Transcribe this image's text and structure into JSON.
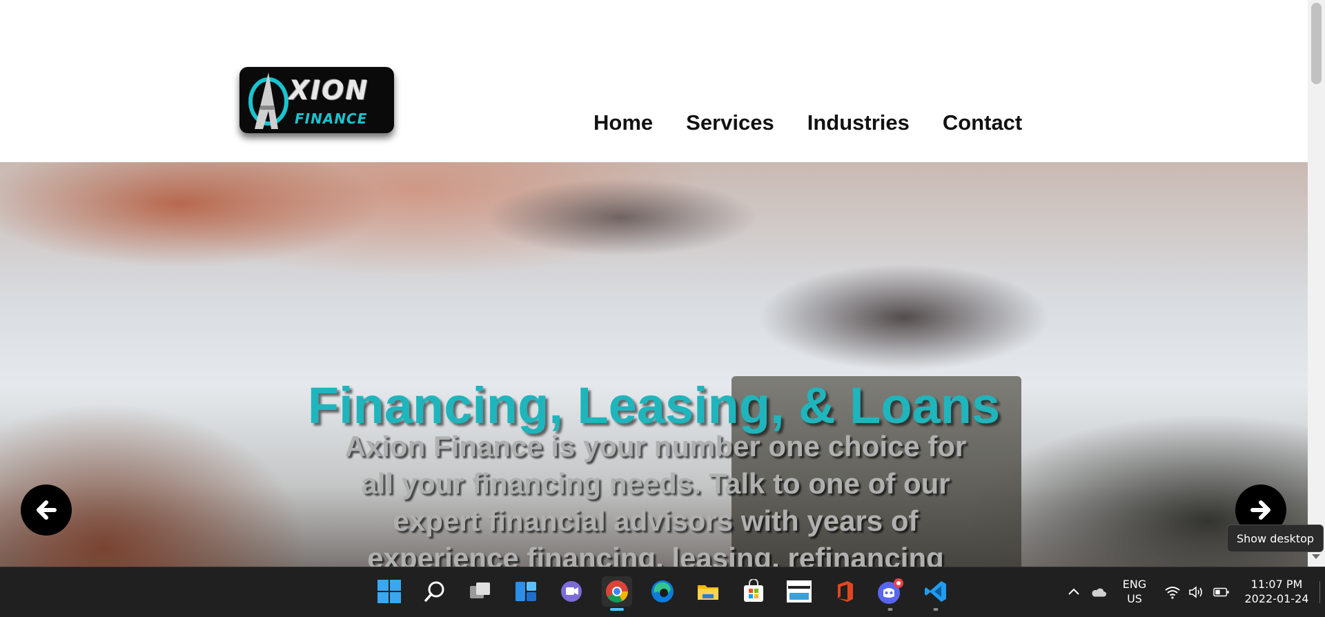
{
  "logo": {
    "main": "XION",
    "sub": "FINANCE"
  },
  "nav": {
    "items": [
      "Home",
      "Services",
      "Industries",
      "Contact"
    ]
  },
  "hero": {
    "title": "Financing, Leasing, & Loans",
    "description": "Axion Finance is your number one choice for all your financing needs. Talk to one of our expert financial advisors with years of experience financing, leasing, refinancing"
  },
  "tooltip": {
    "text": "Show desktop"
  },
  "taskbar": {
    "icons": [
      "windows-start-icon",
      "search-icon",
      "task-view-icon",
      "widgets-icon",
      "teams-chat-icon",
      "chrome-icon",
      "edge-icon",
      "file-explorer-icon",
      "microsoft-store-icon",
      "amazon-icon",
      "office-icon",
      "discord-icon",
      "vscode-icon"
    ],
    "language": {
      "line1": "ENG",
      "line2": "US"
    },
    "time": "11:07 PM",
    "date": "2022-01-24"
  },
  "colors": {
    "accent": "#1fb5bd",
    "taskbar": "#202020"
  }
}
